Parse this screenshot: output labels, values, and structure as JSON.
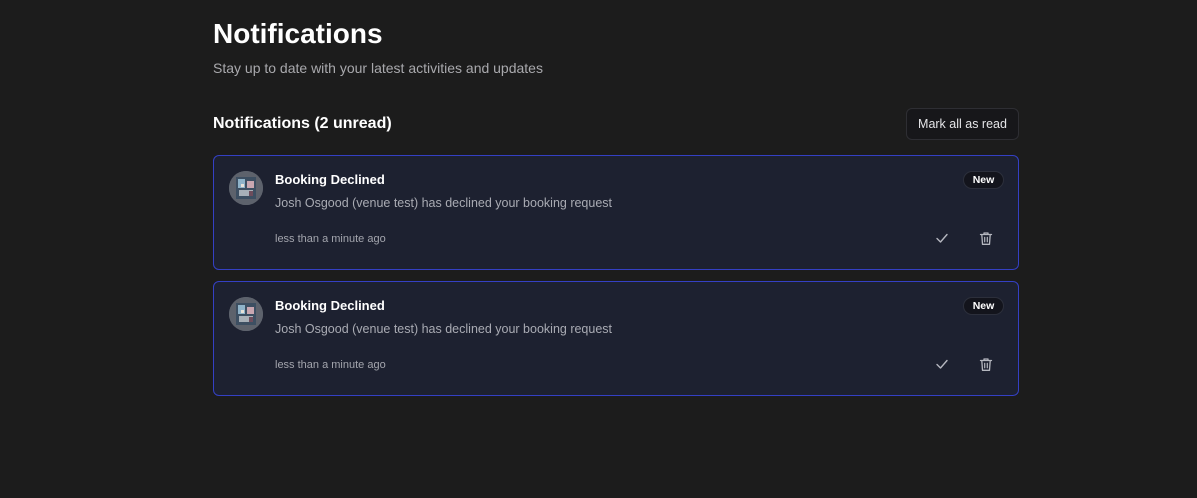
{
  "header": {
    "title": "Notifications",
    "subtitle": "Stay up to date with your latest activities and updates"
  },
  "section": {
    "title": "Notifications (2 unread)",
    "mark_all_label": "Mark all as read"
  },
  "notifications": [
    {
      "title": "Booking Declined",
      "message": "Josh Osgood (venue test) has declined your booking request",
      "time": "less than a minute ago",
      "badge": "New",
      "unread": true,
      "actions": [
        "check-icon",
        "trash-icon"
      ]
    },
    {
      "title": "Booking Declined",
      "message": "Josh Osgood (venue test) has declined your booking request",
      "time": "less than a minute ago",
      "badge": "New",
      "unread": true,
      "actions": [
        "check-icon",
        "trash-icon"
      ]
    }
  ],
  "colors": {
    "background": "#1c1c1c",
    "card_background": "#1d2130",
    "card_border_unread": "#3440c4",
    "muted_text": "#a9a9ad"
  }
}
